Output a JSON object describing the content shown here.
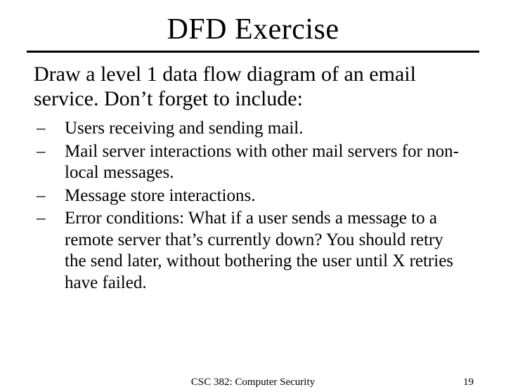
{
  "slide": {
    "title": "DFD Exercise",
    "lead": "Draw a level 1 data flow diagram of an email service.  Don’t forget to include:",
    "bullets": [
      "Users receiving and sending mail.",
      "Mail server interactions with other mail servers for non-local messages.",
      "Message store interactions.",
      "Error conditions: What if a user sends a message to a remote server that’s currently down?  You should retry the send later, without bothering the user until X retries have failed."
    ],
    "footer_center": "CSC 382: Computer Security",
    "footer_page": "19"
  }
}
